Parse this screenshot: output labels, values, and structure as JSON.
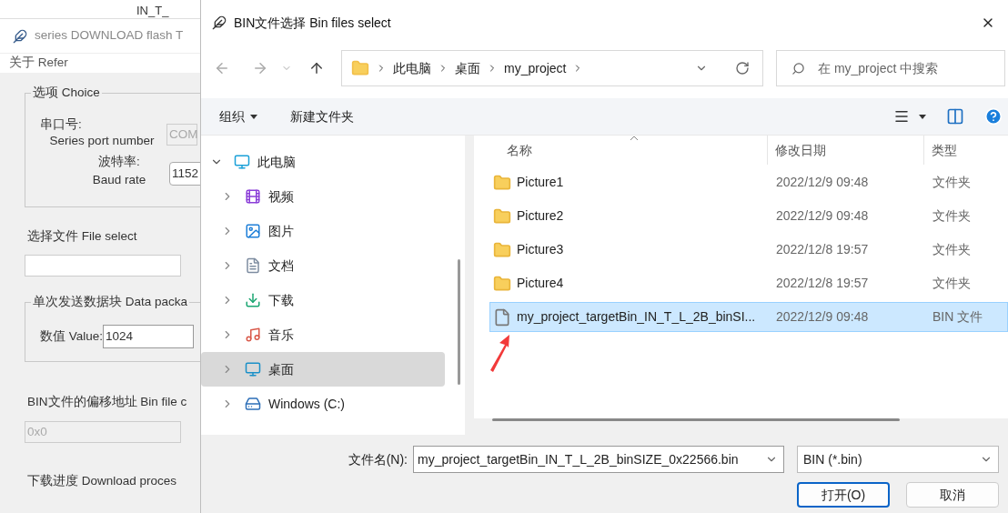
{
  "background_window": {
    "top_strip_text": "IN_T_",
    "title": "series DOWNLOAD flash T",
    "menu": [
      "关于 Refer"
    ],
    "choice_group": {
      "legend": "选项 Choice",
      "port_label_cn": "串口号:",
      "port_label_en": "Series port number",
      "port_value": "COM",
      "port_disabled": true,
      "baud_label_cn": "波特率:",
      "baud_label_en": "Baud rate",
      "baud_value": "1152"
    },
    "file_select": {
      "label": "选择文件 File select"
    },
    "packet_group": {
      "legend": "单次发送数据块 Data packa",
      "value_label": "数值 Value:",
      "value": "1024"
    },
    "offset": {
      "label": "BIN文件的偏移地址 Bin file c",
      "value": "0x0",
      "disabled": true
    },
    "progress_label": "下载进度 Download proces"
  },
  "dialog": {
    "title": "BIN文件选择 Bin files select",
    "address": [
      "此电脑",
      "桌面",
      "my_project"
    ],
    "search_placeholder": "在 my_project 中搜索",
    "toolbar": {
      "organize": "组织",
      "new_folder": "新建文件夹"
    },
    "sidebar": [
      {
        "label": "此电脑",
        "kind": "pc",
        "expanded": true,
        "selected": false,
        "children": [
          {
            "label": "视频",
            "kind": "video",
            "expanded": false,
            "selected": false
          },
          {
            "label": "图片",
            "kind": "pictures",
            "expanded": false,
            "selected": false
          },
          {
            "label": "文档",
            "kind": "documents",
            "expanded": false,
            "selected": false
          },
          {
            "label": "下载",
            "kind": "downloads",
            "expanded": false,
            "selected": false
          },
          {
            "label": "音乐",
            "kind": "music",
            "expanded": false,
            "selected": false
          },
          {
            "label": "桌面",
            "kind": "desktop",
            "expanded": false,
            "selected": true
          },
          {
            "label": "Windows (C:)",
            "kind": "drive",
            "expanded": false,
            "selected": false
          }
        ]
      }
    ],
    "columns": [
      "名称",
      "修改日期",
      "类型"
    ],
    "rows": [
      {
        "name": "Picture1",
        "date": "2022/12/9 09:48",
        "type": "文件夹",
        "kind": "folder",
        "selected": false
      },
      {
        "name": "Picture2",
        "date": "2022/12/9 09:48",
        "type": "文件夹",
        "kind": "folder",
        "selected": false
      },
      {
        "name": "Picture3",
        "date": "2022/12/8 19:57",
        "type": "文件夹",
        "kind": "folder",
        "selected": false
      },
      {
        "name": "Picture4",
        "date": "2022/12/8 19:57",
        "type": "文件夹",
        "kind": "folder",
        "selected": false
      },
      {
        "name": "my_project_targetBin_IN_T_L_2B_binSI...",
        "date": "2022/12/9 09:48",
        "type": "BIN 文件",
        "kind": "file",
        "selected": true
      }
    ],
    "file_name_label": "文件名(N):",
    "file_name_value": "my_project_targetBin_IN_T_L_2B_binSIZE_0x22566.bin",
    "filter": "BIN (*.bin)",
    "buttons": [
      {
        "label": "打开(O)",
        "kind": "primary"
      },
      {
        "label": "取消",
        "kind": "secondary"
      }
    ]
  }
}
